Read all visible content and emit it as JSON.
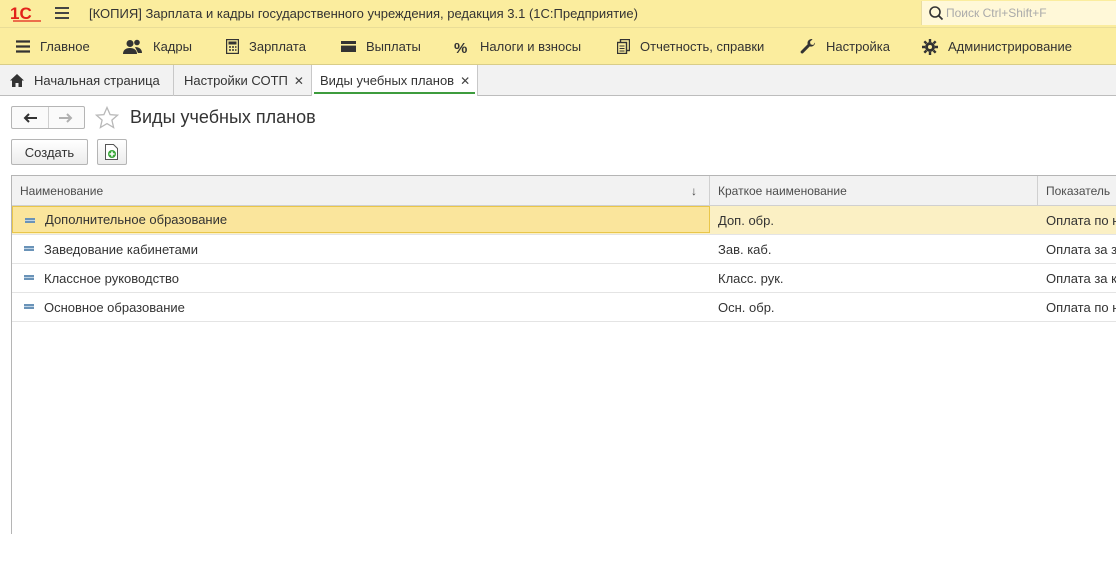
{
  "app": {
    "logo_text": "1С",
    "title": "[КОПИЯ] Зарплата и кадры государственного учреждения, редакция 3.1  (1С:Предприятие)",
    "search": {
      "placeholder": "Поиск Ctrl+Shift+F",
      "value": ""
    }
  },
  "sections": [
    {
      "label": "Главное",
      "icon": "hamburger-icon"
    },
    {
      "label": "Кадры",
      "icon": "people-icon"
    },
    {
      "label": "Зарплата",
      "icon": "calculator-icon"
    },
    {
      "label": "Выплаты",
      "icon": "wallet-icon"
    },
    {
      "label": "Налоги и взносы",
      "icon": "percent-icon"
    },
    {
      "label": "Отчетность, справки",
      "icon": "documents-icon"
    },
    {
      "label": "Настройка",
      "icon": "wrench-icon"
    },
    {
      "label": "Администрирование",
      "icon": "gear-icon"
    }
  ],
  "tabs": [
    {
      "label": "Начальная страница",
      "icon": "home-icon",
      "closable": false,
      "active": false
    },
    {
      "label": "Настройки СОТП",
      "closable": true,
      "active": false
    },
    {
      "label": "Виды учебных планов",
      "closable": true,
      "active": true
    }
  ],
  "form": {
    "title": "Виды учебных планов",
    "create_label": "Создать"
  },
  "table": {
    "columns": [
      "Наименование",
      "Краткое наименование",
      "Показатель"
    ],
    "sort_indicator": "↓",
    "rows": [
      {
        "name": "Дополнительное образование",
        "short": "Доп. обр.",
        "indicator": "Оплата по н",
        "selected": true
      },
      {
        "name": "Заведование кабинетами",
        "short": "Зав. каб.",
        "indicator": "Оплата за з",
        "selected": false
      },
      {
        "name": "Классное руководство",
        "short": "Класс. рук.",
        "indicator": "Оплата за к",
        "selected": false
      },
      {
        "name": "Основное образование",
        "short": "Осн. обр.",
        "indicator": "Оплата по н",
        "selected": false
      }
    ]
  },
  "colors": {
    "header_bg": "#fbed9e",
    "selected_row": "#fbf0c4",
    "selected_cell": "#fae59c",
    "active_tab_underline": "#3d9c3d",
    "logo_red": "#e2231a"
  }
}
